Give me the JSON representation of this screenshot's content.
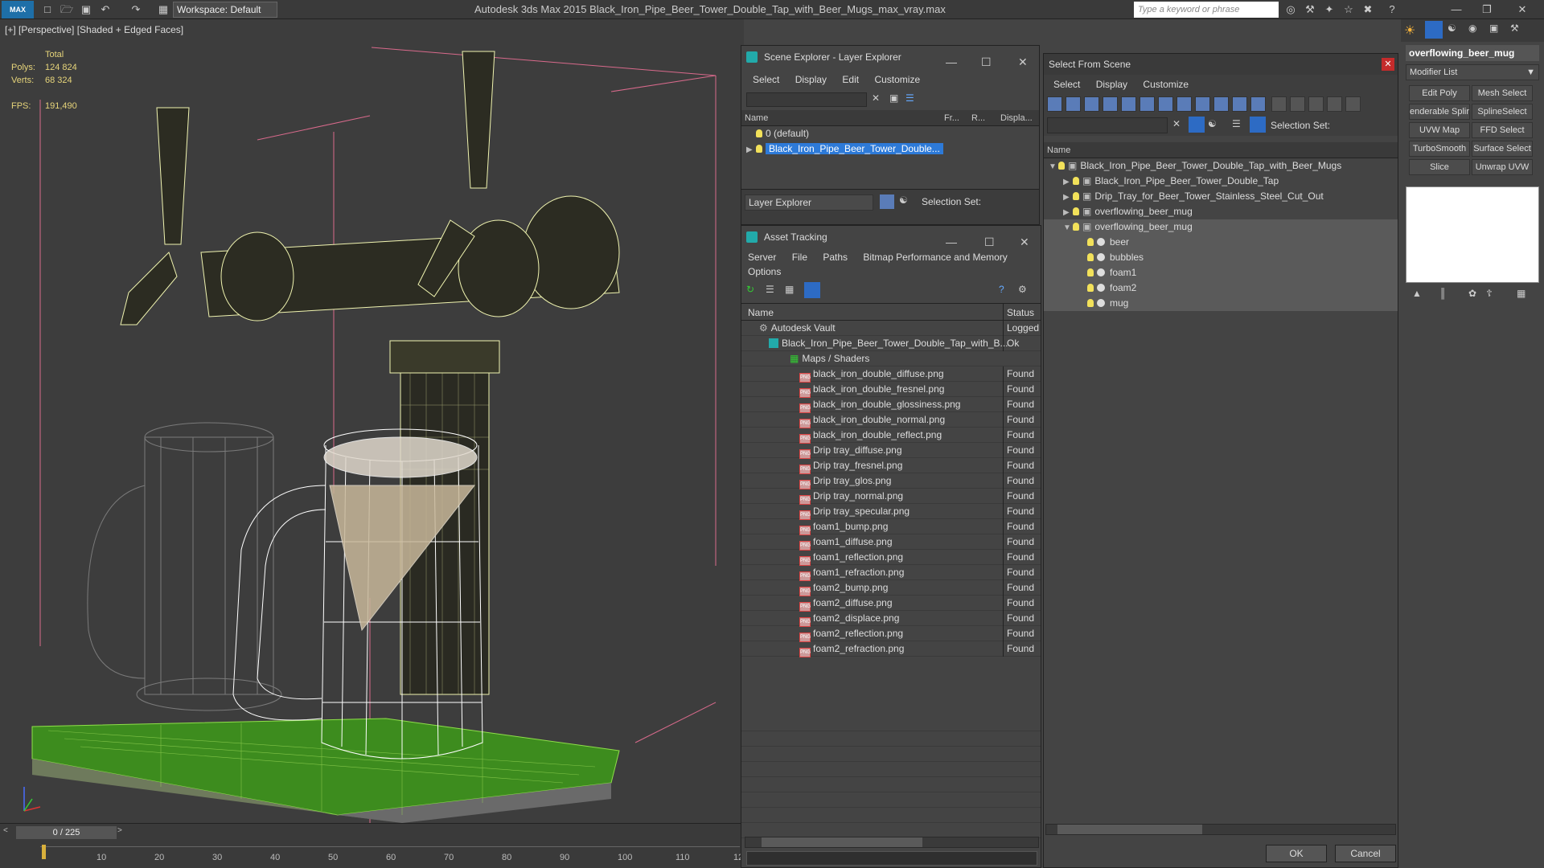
{
  "titlebar": {
    "workspace_label": "Workspace: Default",
    "app_title": "Autodesk 3ds Max  2015     Black_Iron_Pipe_Beer_Tower_Double_Tap_with_Beer_Mugs_max_vray.max",
    "search_placeholder": "Type a keyword or phrase",
    "app_logo": "MAX"
  },
  "viewport": {
    "label": "[+] [Perspective] [Shaded + Edged Faces]",
    "stats": {
      "total_label": "Total",
      "polys_label": "Polys:",
      "polys_value": "124 824",
      "verts_label": "Verts:",
      "verts_value": "68 324",
      "fps_label": "FPS:",
      "fps_value": "191,490"
    }
  },
  "timeline": {
    "frame_counter": "0 / 225",
    "ticks": [
      "10",
      "20",
      "30",
      "40",
      "50",
      "60",
      "70",
      "80",
      "90",
      "100",
      "110",
      "12"
    ]
  },
  "scene_explorer": {
    "title": "Scene Explorer - Layer Explorer",
    "menu": [
      "Select",
      "Display",
      "Edit",
      "Customize"
    ],
    "columns": [
      "Name",
      "Fr...",
      "R...",
      "Displa..."
    ],
    "layers": [
      {
        "name": "0 (default)",
        "selected": false
      },
      {
        "name": "Black_Iron_Pipe_Beer_Tower_Double...",
        "selected": true
      }
    ],
    "footer_dropdown": "Layer Explorer",
    "selection_set_label": "Selection Set:"
  },
  "asset_tracking": {
    "title": "Asset Tracking",
    "menu": [
      "Server",
      "File",
      "Paths",
      "Bitmap Performance and Memory",
      "Options"
    ],
    "columns": [
      "Name",
      "Status"
    ],
    "rows": [
      {
        "name": "Autodesk Vault",
        "status": "Logged"
      },
      {
        "name": "Black_Iron_Pipe_Beer_Tower_Double_Tap_with_B...",
        "status": "Ok"
      },
      {
        "name": "Maps / Shaders",
        "status": ""
      },
      {
        "name": "black_iron_double_diffuse.png",
        "status": "Found"
      },
      {
        "name": "black_iron_double_fresnel.png",
        "status": "Found"
      },
      {
        "name": "black_iron_double_glossiness.png",
        "status": "Found"
      },
      {
        "name": "black_iron_double_normal.png",
        "status": "Found"
      },
      {
        "name": "black_iron_double_reflect.png",
        "status": "Found"
      },
      {
        "name": "Drip tray_diffuse.png",
        "status": "Found"
      },
      {
        "name": "Drip tray_fresnel.png",
        "status": "Found"
      },
      {
        "name": "Drip tray_glos.png",
        "status": "Found"
      },
      {
        "name": "Drip tray_normal.png",
        "status": "Found"
      },
      {
        "name": "Drip tray_specular.png",
        "status": "Found"
      },
      {
        "name": "foam1_bump.png",
        "status": "Found"
      },
      {
        "name": "foam1_diffuse.png",
        "status": "Found"
      },
      {
        "name": "foam1_reflection.png",
        "status": "Found"
      },
      {
        "name": "foam1_refraction.png",
        "status": "Found"
      },
      {
        "name": "foam2_bump.png",
        "status": "Found"
      },
      {
        "name": "foam2_diffuse.png",
        "status": "Found"
      },
      {
        "name": "foam2_displace.png",
        "status": "Found"
      },
      {
        "name": "foam2_reflection.png",
        "status": "Found"
      },
      {
        "name": "foam2_refraction.png",
        "status": "Found"
      }
    ]
  },
  "select_from_scene": {
    "title": "Select From Scene",
    "menu": [
      "Select",
      "Display",
      "Customize"
    ],
    "selection_set_label": "Selection Set:",
    "column": "Name",
    "tree": [
      {
        "name": "Black_Iron_Pipe_Beer_Tower_Double_Tap_with_Beer_Mugs",
        "level": 0,
        "expand": "open"
      },
      {
        "name": "Black_Iron_Pipe_Beer_Tower_Double_Tap",
        "level": 1,
        "expand": "closed"
      },
      {
        "name": "Drip_Tray_for_Beer_Tower_Stainless_Steel_Cut_Out",
        "level": 1,
        "expand": "closed"
      },
      {
        "name": "overflowing_beer_mug",
        "level": 1,
        "expand": "closed"
      },
      {
        "name": "overflowing_beer_mug",
        "level": 1,
        "expand": "open"
      },
      {
        "name": "beer",
        "level": 2,
        "expand": "none"
      },
      {
        "name": "bubbles",
        "level": 2,
        "expand": "none"
      },
      {
        "name": "foam1",
        "level": 2,
        "expand": "none"
      },
      {
        "name": "foam2",
        "level": 2,
        "expand": "none"
      },
      {
        "name": "mug",
        "level": 2,
        "expand": "none"
      }
    ],
    "ok_label": "OK",
    "cancel_label": "Cancel"
  },
  "command_panel": {
    "object_name": "overflowing_beer_mug",
    "modifier_list_label": "Modifier List",
    "modifiers": [
      "Edit Poly",
      "Mesh Select",
      "enderable Splir",
      "SplineSelect",
      "UVW Map",
      "FFD Select",
      "TurboSmooth",
      "Surface Select",
      "Slice",
      "Unwrap UVW"
    ]
  }
}
